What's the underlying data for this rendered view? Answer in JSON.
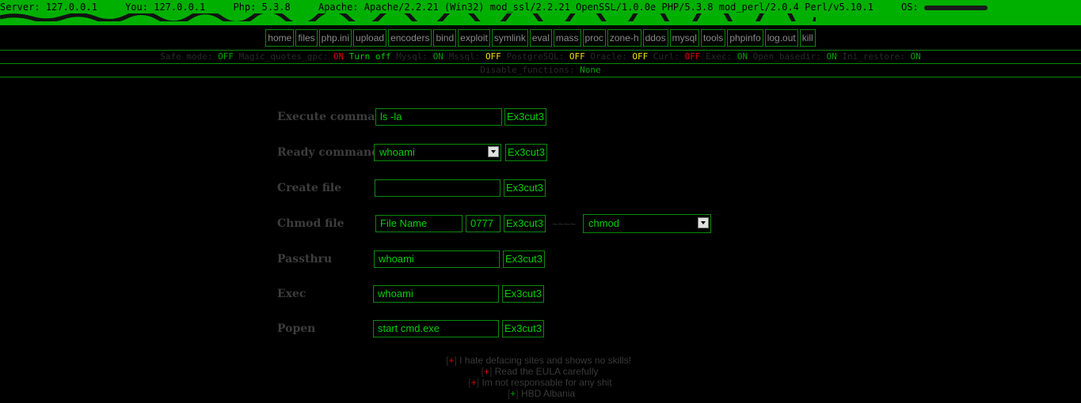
{
  "server_info": {
    "server_label": "Server:",
    "server_value": "127.0.0.1",
    "you_label": "You:",
    "you_value": "127.0.0.1",
    "php_label": "Php:",
    "php_value": "5.3.8",
    "apache_label": "Apache:",
    "apache_value": "Apache/2.2.21 (Win32) mod_ssl/2.2.21 OpenSSL/1.0.0e PHP/5.3.8 mod_perl/2.0.4 Perl/v5.10.1",
    "os_label": "OS:"
  },
  "menu": [
    "home",
    "files",
    "php.ini",
    "upload",
    "encoders",
    "bind",
    "exploit",
    "symlink",
    "eval",
    "mass",
    "proc",
    "zone-h",
    "ddos",
    "mysql",
    "tools",
    "phpinfo",
    "log.out",
    "kill"
  ],
  "status": {
    "safe_mode_label": "Safe mode:",
    "safe_mode": "OFF",
    "magic_label": "Magic_quotes_gpc:",
    "magic": "ON",
    "turn_off": "Turn off",
    "mysql_label": "Mysql:",
    "mysql": "ON",
    "mssql_label": "Mssql:",
    "mssql": "OFF",
    "pg_label": "PostgreSQL:",
    "pg": "OFF",
    "oracle_label": "Oracle:",
    "oracle": "OFF",
    "curl_label": "Curl:",
    "curl": "OFF",
    "exec_label": "Exec:",
    "exec": "ON",
    "openbasedir_label": "Open_basedir:",
    "openbasedir": "ON",
    "iniRestore_label": "Ini_restore:",
    "iniRestore": "ON"
  },
  "disable": {
    "label": "Disable_functions:",
    "value": "None"
  },
  "form": {
    "execute": {
      "label": "Execute command",
      "value": "ls -la",
      "button": "Ex3cut3"
    },
    "ready": {
      "label": "Ready commands",
      "selected": "whoami",
      "button": "Ex3cut3"
    },
    "create": {
      "label": "Create file",
      "value": "",
      "button": "Ex3cut3"
    },
    "chmod": {
      "label": "Chmod file",
      "filename": "File Name",
      "mode": "0777",
      "button": "Ex3cut3",
      "separator": "~~~~",
      "selected": "chmod"
    },
    "passthru": {
      "label": "Passthru",
      "value": "whoami",
      "button": "Ex3cut3"
    },
    "exec": {
      "label": "Exec",
      "value": "whoami",
      "button": "Ex3cut3"
    },
    "popen": {
      "label": "Popen",
      "value": "start cmd.exe",
      "button": "Ex3cut3"
    }
  },
  "footer": [
    {
      "mark": "+",
      "text": "I hate defacing sites and shows no skills!"
    },
    {
      "mark": "+",
      "text": "Read the EULA carefully"
    },
    {
      "mark": "+",
      "text": "Im not responsable for any shit"
    },
    {
      "mark": "+",
      "text": "HBD Albania"
    }
  ],
  "colors": {
    "accent": "#00b000",
    "on": "#00a000",
    "off_red": "#e00000",
    "off_yellow": "#f0e000"
  }
}
